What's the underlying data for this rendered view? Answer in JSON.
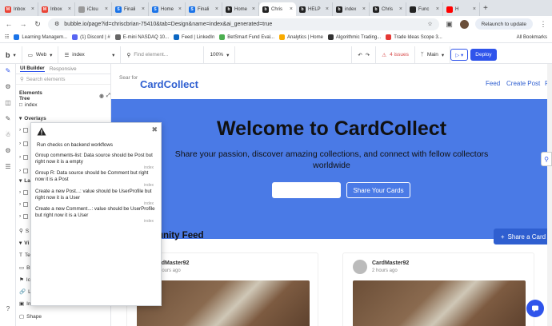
{
  "browser": {
    "tabs": [
      {
        "label": "Inbox",
        "icon": "gmail-icon",
        "color": "#ea4335",
        "letter": "M"
      },
      {
        "label": "Inbox",
        "icon": "gmail-icon",
        "color": "#ea4335",
        "letter": "M"
      },
      {
        "label": "iClou",
        "icon": "apple-icon",
        "color": "#999999",
        "letter": ""
      },
      {
        "label": "Finali",
        "icon": "doc-icon",
        "color": "#1a73e8",
        "letter": "S"
      },
      {
        "label": "Home",
        "icon": "doc-icon",
        "color": "#1a73e8",
        "letter": "S"
      },
      {
        "label": "Finali",
        "icon": "doc-icon",
        "color": "#1a73e8",
        "letter": "S"
      },
      {
        "label": "Home",
        "icon": "bubble-icon",
        "color": "#222222",
        "letter": "b"
      },
      {
        "label": "Chris",
        "icon": "bubble-icon",
        "color": "#222222",
        "letter": "b",
        "active": true
      },
      {
        "label": "HELP",
        "icon": "bubble-icon",
        "color": "#222222",
        "letter": "b"
      },
      {
        "label": "index",
        "icon": "bubble-icon",
        "color": "#222222",
        "letter": "b"
      },
      {
        "label": "Chris",
        "icon": "bubble-icon",
        "color": "#222222",
        "letter": "b"
      },
      {
        "label": "Func",
        "icon": "github-icon",
        "color": "#222222",
        "letter": ""
      },
      {
        "label": "H",
        "icon": "youtube-icon",
        "color": "#ff0000",
        "letter": ""
      }
    ],
    "url": "bubble.io/page?id=chriscbrian-75410&tab=Design&name=index&ai_generated=true",
    "relaunch": "Relaunch to update",
    "bookmarks": [
      {
        "label": "Learning Managem...",
        "color": "#1a73e8"
      },
      {
        "label": "(1) Discord | #",
        "color": "#5865f2"
      },
      {
        "label": "E-mini NASDAQ 10...",
        "color": "#666666"
      },
      {
        "label": "Feed | LinkedIn",
        "color": "#0a66c2"
      },
      {
        "label": "BetSmart Fund Eval...",
        "color": "#4caf50"
      },
      {
        "label": "Analytics | Home",
        "color": "#f9ab00"
      },
      {
        "label": "Algorithmic Trading...",
        "color": "#333333"
      },
      {
        "label": "Trade Ideas Scope 3...",
        "color": "#e53935"
      }
    ],
    "all_bookmarks": "All Bookmarks"
  },
  "toolbar": {
    "device": "Web",
    "page": "index",
    "find": "Find element...",
    "zoom": "100%",
    "issues": "4 issues",
    "branch": "Main",
    "deploy": "Deploy"
  },
  "panel": {
    "tab_builder": "UI Builder",
    "tab_responsive": "Responsive",
    "search_placeholder": "Search elements",
    "tree_title": "Elements Tree",
    "root": "index",
    "overlays": "Overlays",
    "layers_partial": "La",
    "search_partial": "S",
    "visual_partial": "Vi",
    "items_partial": [
      "Te",
      "Bu",
      "Ic",
      "Li",
      "Im"
    ],
    "shape": "Shape"
  },
  "popup": {
    "run_checks": "Run checks on backend workflows",
    "issues": [
      {
        "text": "Group comments-list: Data source should be Post but right now it is a empty",
        "page": "index"
      },
      {
        "text": "Group R: Data source should be Comment but right now it is a Post",
        "page": "index"
      },
      {
        "text": "Create a new Post...: value should be UserProfile but right now it is a User",
        "page": "index"
      },
      {
        "text": "Create a new Comment...: value should be UserProfile but right now it is a User",
        "page": "index"
      }
    ]
  },
  "app": {
    "logo_text": "Sear for",
    "brand": "CardCollect",
    "nav": [
      "Feed",
      "Create Post",
      "Pr"
    ],
    "hero_title": "Welcome to CardCollect",
    "hero_subtitle": "Share your passion, discover amazing collections, and connect with fellow collectors worldwide",
    "hero_button": "Share Your Cards",
    "feed_title": "unity Feed",
    "share_button": "Share a Card",
    "cards": [
      {
        "user": "rdMaster92",
        "time": "hours ago"
      },
      {
        "user": "CardMaster92",
        "time": "2 hours ago"
      }
    ],
    "colors": {
      "primary": "#2f5fd0",
      "hero": "#4a7ae6"
    }
  }
}
